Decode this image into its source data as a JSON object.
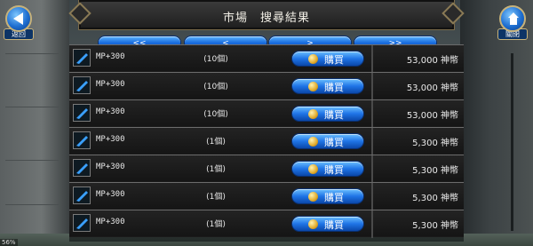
{
  "header": {
    "title": "市場　搜尋結果"
  },
  "back_button": {
    "label": "返回"
  },
  "close_button": {
    "label": "關閉"
  },
  "pager": {
    "first": "<<",
    "prev": "<",
    "next": ">",
    "last": ">>"
  },
  "rows": [
    {
      "name": "MP+300",
      "qty": "(10個)",
      "buy": "購買",
      "price": "53,000",
      "currency": "神幣"
    },
    {
      "name": "MP+300",
      "qty": "(10個)",
      "buy": "購買",
      "price": "53,000",
      "currency": "神幣"
    },
    {
      "name": "MP+300",
      "qty": "(10個)",
      "buy": "購買",
      "price": "53,000",
      "currency": "神幣"
    },
    {
      "name": "MP+300",
      "qty": "(1個)",
      "buy": "購買",
      "price": "5,300",
      "currency": "神幣"
    },
    {
      "name": "MP+300",
      "qty": "(1個)",
      "buy": "購買",
      "price": "5,300",
      "currency": "神幣"
    },
    {
      "name": "MP+300",
      "qty": "(1個)",
      "buy": "購買",
      "price": "5,300",
      "currency": "神幣"
    },
    {
      "name": "MP+300",
      "qty": "(1個)",
      "buy": "購買",
      "price": "5,300",
      "currency": "神幣"
    }
  ],
  "status": {
    "text": "56%"
  },
  "colors": {
    "button_blue": "#1f74e6",
    "frame_gold": "#c7b27a"
  },
  "icons": {
    "item": "potion-feather-icon",
    "coin": "gold-coin-icon"
  }
}
